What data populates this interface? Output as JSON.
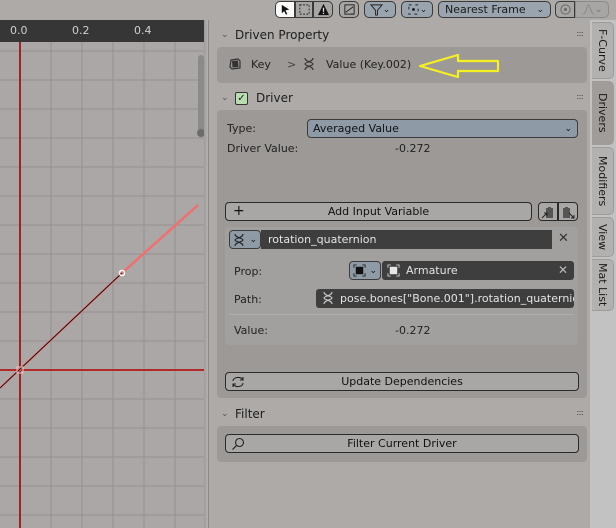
{
  "toolbar": {
    "interpolation_mode": "Nearest Frame",
    "icons": [
      "select-cursor-icon",
      "box-select-icon",
      "warning-icon",
      "normalize-icon",
      "filter-icon",
      "pivot-icon",
      "proportional-edit-icon",
      "falloff-icon"
    ]
  },
  "graph": {
    "ruler_ticks": [
      "0.0",
      "0.2",
      "0.4"
    ],
    "colors": {
      "curve_selected": "#f07070",
      "curve_line": "#111111",
      "cursor": "#a02020",
      "grid": "#959292"
    }
  },
  "driven_property": {
    "title": "Driven Property",
    "breadcrumb": {
      "object_label": "Key",
      "separator": ">",
      "property_label": "Value (Key.002)"
    }
  },
  "driver": {
    "title": "Driver",
    "enabled": true,
    "type_label": "Type:",
    "type_value": "Averaged Value",
    "driver_value_label": "Driver Value:",
    "driver_value": "-0.272",
    "add_variable_label": "Add Input Variable",
    "variable": {
      "name": "rotation_quaternion",
      "prop_label": "Prop:",
      "prop_object": "Armature",
      "path_label": "Path:",
      "path_value": "pose.bones[\"Bone.001\"].rotation_quaternio...",
      "value_label": "Value:",
      "value": "-0.272"
    },
    "update_dependencies_label": "Update Dependencies"
  },
  "filter": {
    "title": "Filter",
    "filter_button_label": "Filter Current Driver"
  },
  "tabs": [
    {
      "label": "F-Curve",
      "active": false
    },
    {
      "label": "Drivers",
      "active": true
    },
    {
      "label": "Modifiers",
      "active": false
    },
    {
      "label": "View",
      "active": false
    },
    {
      "label": "Mat List",
      "active": false
    }
  ],
  "annotation": {
    "color": "#f5f020"
  }
}
